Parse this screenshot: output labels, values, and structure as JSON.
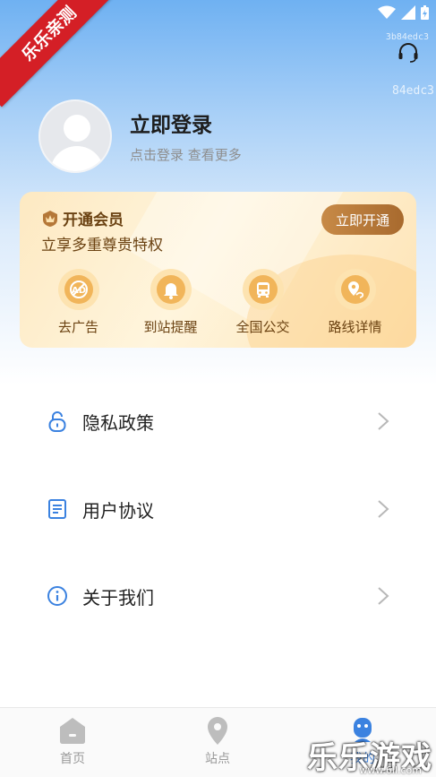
{
  "watermark": {
    "corner": "乐乐亲测",
    "bottom_right": "乐乐游戏",
    "bottom_right_url": "www.6ll.com"
  },
  "hashes": {
    "small": "3b84edc3",
    "big": "84edc3"
  },
  "colors": {
    "primary": "#3b82e0",
    "gold_text": "#6b4212",
    "gold_button": "#b57838",
    "watermark_red": "#d41f26"
  },
  "icons": {
    "support": "headset-icon",
    "avatar": "default-avatar"
  },
  "profile": {
    "title": "立即登录",
    "subtitle": "点击登录 查看更多"
  },
  "vip": {
    "title": "开通会员",
    "subtitle": "立享多重尊贵特权",
    "button": "立即开通",
    "perks": [
      {
        "label": "去广告",
        "icon": "no-ads-icon"
      },
      {
        "label": "到站提醒",
        "icon": "bell-icon"
      },
      {
        "label": "全国公交",
        "icon": "bus-icon"
      },
      {
        "label": "路线详情",
        "icon": "route-pin-icon"
      }
    ]
  },
  "menu": [
    {
      "label": "隐私政策",
      "icon": "lock-icon"
    },
    {
      "label": "用户协议",
      "icon": "document-icon"
    },
    {
      "label": "关于我们",
      "icon": "info-icon"
    }
  ],
  "tabs": [
    {
      "label": "首页",
      "icon": "home-icon",
      "active": false
    },
    {
      "label": "站点",
      "icon": "location-pin-icon",
      "active": false
    },
    {
      "label": "我的",
      "icon": "profile-icon",
      "active": true
    }
  ]
}
